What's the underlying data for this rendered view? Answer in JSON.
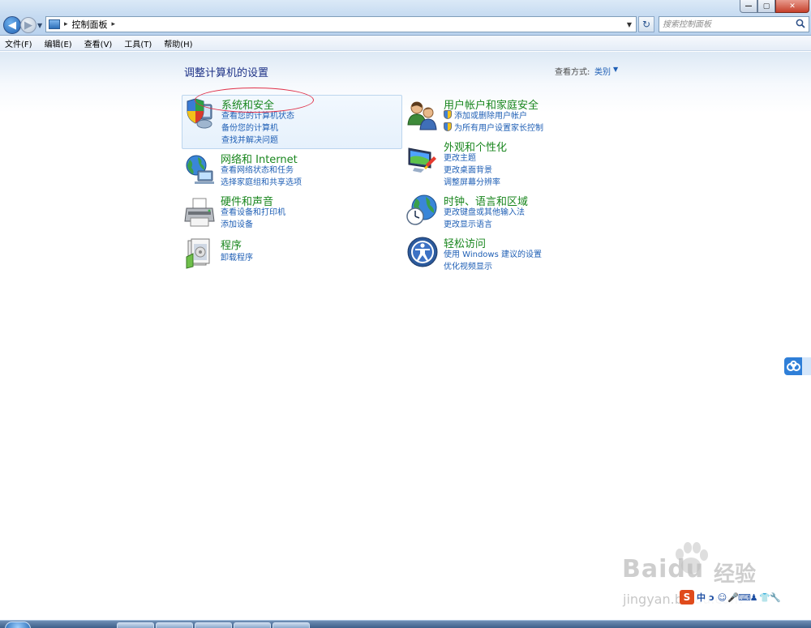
{
  "window": {
    "controls": {
      "minimize": "—",
      "maximize": "▢",
      "close": "✕"
    }
  },
  "address_bar": {
    "path": [
      "控制面板"
    ],
    "search_placeholder": "搜索控制面板"
  },
  "menu": [
    "文件(F)",
    "编辑(E)",
    "查看(V)",
    "工具(T)",
    "帮助(H)"
  ],
  "content": {
    "title": "调整计算机的设置",
    "view_by_label": "查看方式:",
    "view_by_value": "类别"
  },
  "categories": [
    {
      "title": "系统和安全",
      "icon": "shield-computer-icon",
      "links": [
        "查看您的计算机状态",
        "备份您的计算机",
        "查找并解决问题"
      ]
    },
    {
      "title": "用户帐户和家庭安全",
      "icon": "users-icon",
      "links": [
        "添加或删除用户帐户",
        "为所有用户设置家长控制"
      ]
    },
    {
      "title": "网络和 Internet",
      "icon": "network-globe-icon",
      "links": [
        "查看网络状态和任务",
        "选择家庭组和共享选项"
      ]
    },
    {
      "title": "外观和个性化",
      "icon": "display-appearance-icon",
      "links": [
        "更改主题",
        "更改桌面背景",
        "调整屏幕分辨率"
      ]
    },
    {
      "title": "硬件和声音",
      "icon": "printer-icon",
      "links": [
        "查看设备和打印机",
        "添加设备"
      ]
    },
    {
      "title": "时钟、语言和区域",
      "icon": "globe-clock-icon",
      "links": [
        "更改键盘或其他输入法",
        "更改显示语言"
      ]
    },
    {
      "title": "程序",
      "icon": "programs-icon",
      "links": [
        "卸载程序"
      ]
    },
    {
      "title": "轻松访问",
      "icon": "ease-of-access-icon",
      "links": [
        "使用 Windows 建议的设置",
        "优化视频显示"
      ]
    }
  ],
  "watermark": {
    "logo": "Baidu",
    "text": "经验",
    "url": "jingyan.baidu.com"
  },
  "ime_bar": {
    "logo": "S",
    "items": [
      "中",
      "ɔ",
      "☺",
      "🎤",
      "⌨",
      "♟",
      "👕",
      "🔧"
    ]
  },
  "colors": {
    "category_title": "#19861e",
    "link": "#1f5fb5",
    "page_title": "#1e3287",
    "highlight_oval": "#e0324a"
  }
}
